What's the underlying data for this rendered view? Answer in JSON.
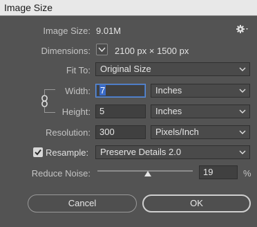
{
  "window": {
    "title": "Image Size"
  },
  "image_size": {
    "label": "Image Size:",
    "value": "9.01M"
  },
  "dimensions": {
    "label": "Dimensions:",
    "value": "2100 px  ×  1500 px"
  },
  "fit_to": {
    "label": "Fit To:",
    "value": "Original Size"
  },
  "width": {
    "label": "Width:",
    "value": "7",
    "unit": "Inches"
  },
  "height": {
    "label": "Height:",
    "value": "5",
    "unit": "Inches"
  },
  "resolution": {
    "label": "Resolution:",
    "value": "300",
    "unit": "Pixels/Inch"
  },
  "resample": {
    "label": "Resample:",
    "checked": true,
    "value": "Preserve Details 2.0"
  },
  "reduce_noise": {
    "label": "Reduce Noise:",
    "value": "19",
    "unit": "%",
    "level": 0.19
  },
  "buttons": {
    "cancel": "Cancel",
    "ok": "OK"
  },
  "icons": {
    "settings": "gear-icon",
    "link": "link-icon",
    "dropdown": "chevron-down-icon"
  }
}
